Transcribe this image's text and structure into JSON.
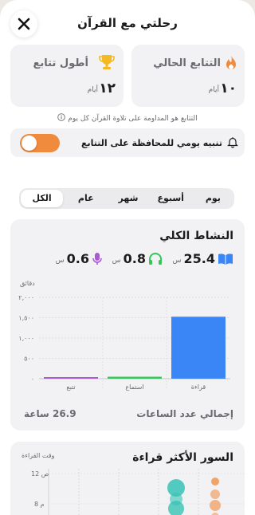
{
  "header": {
    "title": "رحلتي مع القرآن"
  },
  "streak": {
    "current_label": "التتابع الحالي",
    "current_value": "١٠",
    "current_unit": "أيام",
    "longest_label": "أطول تتابع",
    "longest_value": "١٢",
    "longest_unit": "أيام",
    "note": "التتابع هو المداومة على تلاوة القرآن كل يوم"
  },
  "reminder": {
    "label": "تنبيه يومي للمحافظة على التتابع",
    "enabled": true
  },
  "range_tabs": [
    {
      "label": "يوم",
      "active": false
    },
    {
      "label": "أسبوع",
      "active": false
    },
    {
      "label": "شهر",
      "active": false
    },
    {
      "label": "عام",
      "active": false
    },
    {
      "label": "الكل",
      "active": true
    }
  ],
  "activity": {
    "title": "النشاط الكلي",
    "metrics": [
      {
        "value": "25.4",
        "unit": "س",
        "icon": "book-icon"
      },
      {
        "value": "0.8",
        "unit": "س",
        "icon": "headphones-icon"
      },
      {
        "value": "0.6",
        "unit": "س",
        "icon": "microphone-icon"
      }
    ],
    "total_label": "إجمالي عدد الساعات",
    "total_value": "26.9 ساعة"
  },
  "colors": {
    "accent_orange": "#f08a3c",
    "blue": "#3a86f7",
    "green": "#34c759",
    "purple": "#a95bd6",
    "teal": "#37c3b5"
  },
  "chart_data": {
    "type": "bar",
    "ylabel": "دقائق",
    "categories": [
      "قراءة",
      "استماع",
      "تتبع"
    ],
    "values": [
      1524,
      48,
      36
    ],
    "yticks": [
      "٠",
      "٥٠٠",
      "١,٠٠٠",
      "١,٥٠٠",
      "٢,٠٠٠"
    ],
    "ylim": [
      0,
      2000
    ],
    "grid": true
  },
  "surahs": {
    "title": "السور الأكثر قراءة",
    "time_axis_label": "وقت القراءة",
    "time_ticks": [
      "12 ص",
      "8 م"
    ]
  }
}
